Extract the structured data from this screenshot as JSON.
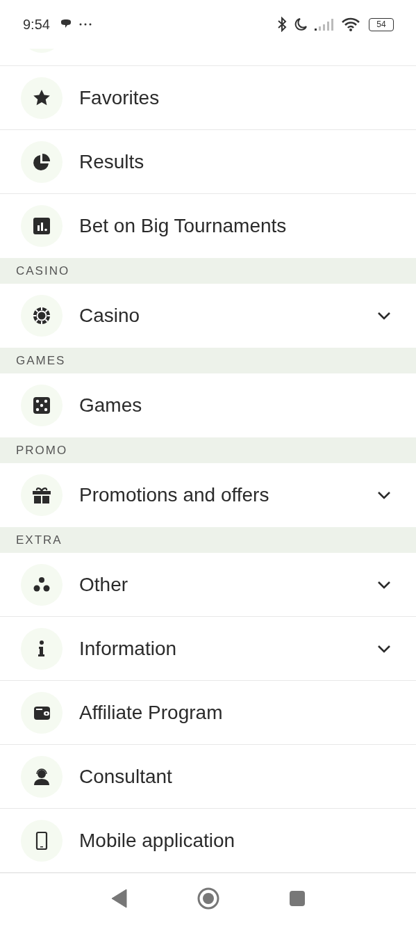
{
  "status_bar": {
    "time": "9:54",
    "battery": "54"
  },
  "menu": [
    {
      "kind": "item",
      "label": "Favorites",
      "expandable": false
    },
    {
      "kind": "item",
      "label": "Results",
      "expandable": false
    },
    {
      "kind": "item",
      "label": "Bet on Big Tournaments",
      "expandable": false
    },
    {
      "kind": "header",
      "label": "CASINO"
    },
    {
      "kind": "item",
      "label": "Casino",
      "expandable": true
    },
    {
      "kind": "header",
      "label": "GAMES"
    },
    {
      "kind": "item",
      "label": "Games",
      "expandable": false
    },
    {
      "kind": "header",
      "label": "PROMO"
    },
    {
      "kind": "item",
      "label": "Promotions and offers",
      "expandable": true
    },
    {
      "kind": "header",
      "label": "EXTRA"
    },
    {
      "kind": "item",
      "label": "Other",
      "expandable": true
    },
    {
      "kind": "item",
      "label": "Information",
      "expandable": true
    },
    {
      "kind": "item",
      "label": "Affiliate Program",
      "expandable": false
    },
    {
      "kind": "item",
      "label": "Consultant",
      "expandable": false
    },
    {
      "kind": "item",
      "label": "Mobile application",
      "expandable": false
    }
  ]
}
